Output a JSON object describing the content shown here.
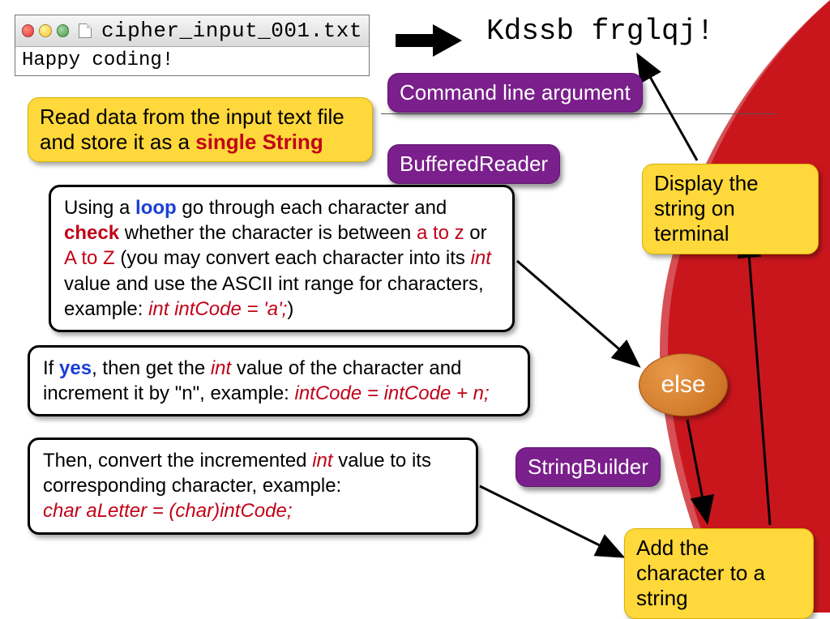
{
  "file": {
    "name": "cipher_input_001.txt",
    "content": "Happy coding!"
  },
  "output": "Kdssb frglqj!",
  "boxes": {
    "read_prefix": "Read data from the input text file and store it as a ",
    "read_emph": "single String",
    "cmd_line": "Command line argument",
    "buffered_reader": "BufferedReader",
    "loop_t1": "Using a ",
    "loop_word": "loop",
    "loop_t2": " go through each character and ",
    "check_word": "check",
    "loop_t3": " whether the character is between ",
    "az_lower": "a to z",
    "loop_t4": " or ",
    "az_upper": "A to Z",
    "loop_t5": " (you may convert each character into its ",
    "int_word": "int",
    "loop_t6": " value and use the ASCII int range for characters, example: ",
    "loop_example": "int intCode = 'a';",
    "loop_close": ")",
    "yes_t1": "If ",
    "yes_word": "yes",
    "yes_t2": ", then get the ",
    "yes_t3": " value of the character and increment it by \"n\", example: ",
    "yes_example": "intCode = intCode + n;",
    "convert_t1": "Then, convert the incremented ",
    "convert_t2": " value to its corresponding character, example:",
    "convert_example": "char aLetter = (char)intCode;",
    "string_builder": "StringBuilder",
    "else_label": "else",
    "display": "Display the string on terminal",
    "add_char": "Add the character to a string"
  }
}
